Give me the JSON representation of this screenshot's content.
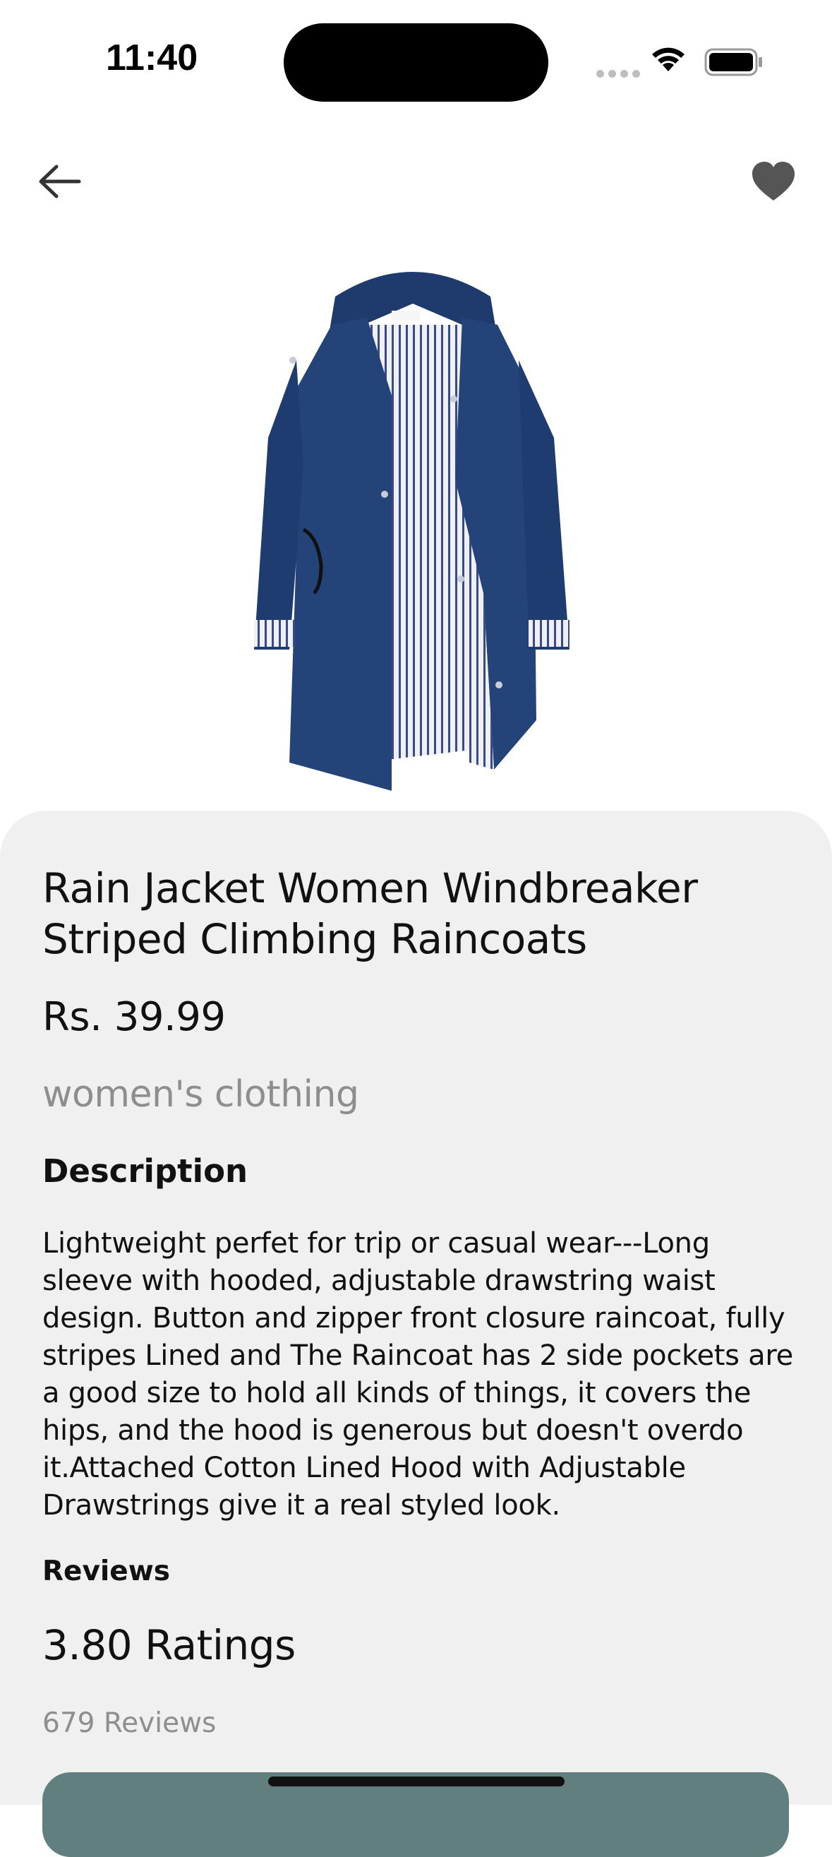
{
  "status_bar": {
    "time": "11:40"
  },
  "nav": {
    "back_icon": "arrow-left-icon",
    "favorite_icon": "heart-icon",
    "favorite_color": "#555555"
  },
  "product": {
    "image_icon": "rain-jacket-image",
    "title": "Rain Jacket Women Windbreaker Striped Climbing Raincoats",
    "price": "Rs. 39.99",
    "category": "women's clothing",
    "description_heading": "Description",
    "description": "Lightweight perfet for trip or casual wear---Long sleeve with hooded, adjustable drawstring waist design. Button and zipper front closure raincoat, fully stripes Lined and The Raincoat has 2 side pockets are a good size to hold all kinds of things, it covers the hips, and the hood is generous but doesn't overdo it.Attached Cotton Lined Hood with Adjustable Drawstrings give it a real styled look.",
    "reviews_heading": "Reviews",
    "ratings": "3.80 Ratings",
    "review_count": "679 Reviews"
  },
  "colors": {
    "panel_bg": "#f0f0f0",
    "accent_button": "#627f80",
    "muted_text": "#8e8e8e"
  }
}
